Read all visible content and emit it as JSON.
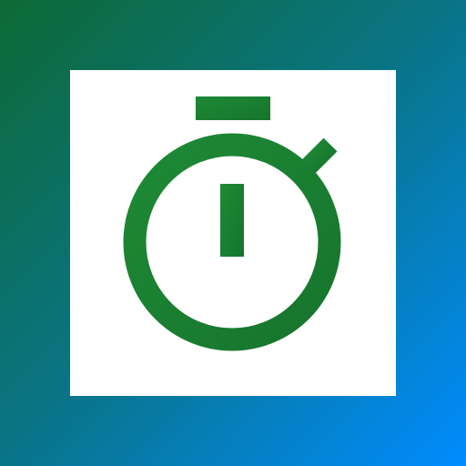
{
  "app_icon": {
    "icon": "stopwatch-icon",
    "colors": {
      "background_gradient_start": "#0e6a35",
      "background_gradient_end": "#008cff",
      "tile": "#ffffff",
      "glyph": "#1b7d32"
    }
  }
}
